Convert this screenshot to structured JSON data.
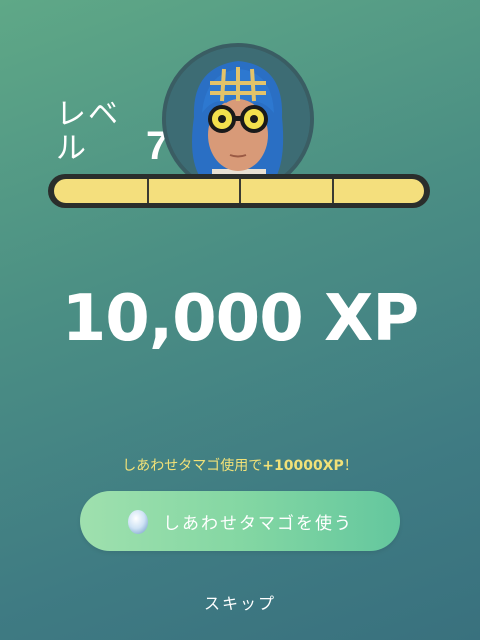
{
  "level": {
    "label": "レベ\nル",
    "value": "70"
  },
  "avatar": {
    "description_icon": "trainer-avatar"
  },
  "xp_bar": {
    "segments": 4,
    "fill_fraction": 1.0
  },
  "xp_reward": "10,000 XP",
  "promo": {
    "prefix": "しあわせタマゴ使用で",
    "bonus": "+10000XP",
    "suffix": "！"
  },
  "egg_button": {
    "label": "しあわせタマゴを使う",
    "icon": "lucky-egg-icon"
  },
  "skip": {
    "label": "スキップ"
  },
  "colors": {
    "bar_fill": "#f4df7d",
    "promo_text": "#f1e178",
    "button_start": "#9fe0ae",
    "button_end": "#64c79e"
  }
}
